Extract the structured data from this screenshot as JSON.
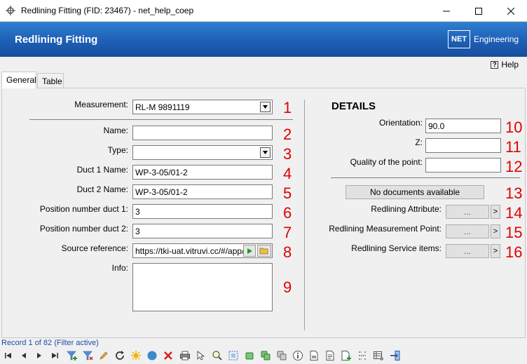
{
  "window": {
    "title": "Redlining Fitting (FID: 23467) - net_help_coep"
  },
  "header": {
    "title": "Redlining Fitting",
    "logo_text": "NET",
    "logo_subtext": "Engineering"
  },
  "help_label": "Help",
  "tabs": [
    {
      "label": "General",
      "active": true
    },
    {
      "label": "Table",
      "active": false
    }
  ],
  "left_fields": {
    "measurement": {
      "label": "Measurement:",
      "value": "RL-M 9891119",
      "number": "1"
    },
    "name": {
      "label": "Name:",
      "value": "",
      "number": "2"
    },
    "type": {
      "label": "Type:",
      "value": "",
      "number": "3"
    },
    "duct1": {
      "label": "Duct 1 Name:",
      "value": "WP-3-05/01-2",
      "number": "4"
    },
    "duct2": {
      "label": "Duct 2 Name:",
      "value": "WP-3-05/01-2",
      "number": "5"
    },
    "pos1": {
      "label": "Position number duct 1:",
      "value": "3",
      "number": "6"
    },
    "pos2": {
      "label": "Position number duct 2:",
      "value": "3",
      "number": "7"
    },
    "source": {
      "label": "Source reference:",
      "value": "https://tki-uat.vitruvi.cc/#/app/e",
      "number": "8"
    },
    "info": {
      "label": "Info:",
      "value": "",
      "number": "9"
    }
  },
  "details": {
    "title": "DETAILS",
    "orientation": {
      "label": "Orientation:",
      "value": "90.0",
      "number": "10"
    },
    "z": {
      "label": "Z:",
      "value": "",
      "number": "11"
    },
    "quality": {
      "label": "Quality of the point:",
      "value": "",
      "number": "12"
    },
    "documents": {
      "label": "No documents available",
      "number": "13"
    },
    "attribute": {
      "label": "Redlining Attribute:",
      "button": "...",
      "arrow": ">",
      "number": "14"
    },
    "measurement_point": {
      "label": "Redlining Measurement Point:",
      "button": "...",
      "arrow": ">",
      "number": "15"
    },
    "service_items": {
      "label": "Redlining Service items:",
      "button": "...",
      "arrow": ">",
      "number": "16"
    }
  },
  "status": {
    "record_text": "Record 1 of 82 (Filter active)"
  },
  "colors": {
    "header_blue": "#1e5fb5",
    "annotation_red": "#e00000",
    "status_blue": "#1a4ea8"
  }
}
